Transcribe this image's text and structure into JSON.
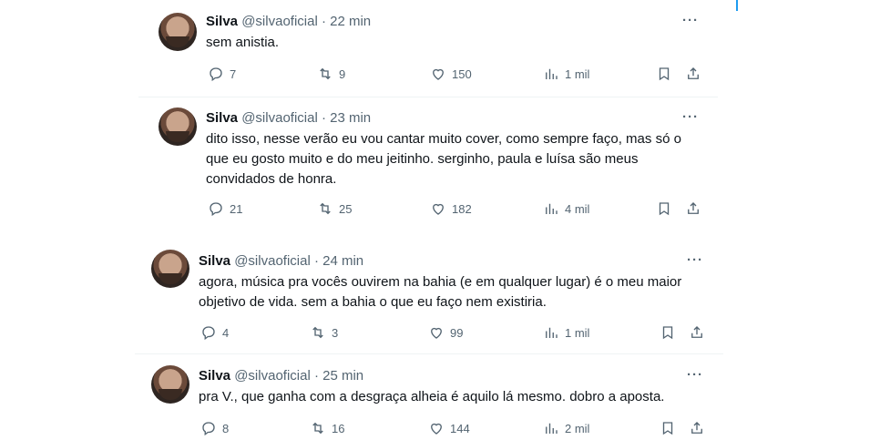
{
  "tweets": [
    {
      "name": "Silva",
      "handle": "@silvaoficial",
      "time": "· 22 min",
      "text": "sem anistia.",
      "replies": "7",
      "retweets": "9",
      "likes": "150",
      "views": "1 mil",
      "more": "···"
    },
    {
      "name": "Silva",
      "handle": "@silvaoficial",
      "time": "· 23 min",
      "text": "dito isso, nesse verão eu vou cantar muito cover, como sempre faço, mas só o que eu gosto muito e do meu jeitinho. serginho, paula e luísa são meus convidados de honra.",
      "replies": "21",
      "retweets": "25",
      "likes": "182",
      "views": "4 mil",
      "more": "···"
    },
    {
      "name": "Silva",
      "handle": "@silvaoficial",
      "time": "· 24 min",
      "text": "agora, música pra vocês ouvirem na bahia (e em qualquer lugar) é o meu maior objetivo de vida. sem a bahia o que eu faço nem existiria.",
      "replies": "4",
      "retweets": "3",
      "likes": "99",
      "views": "1 mil",
      "more": "···"
    },
    {
      "name": "Silva",
      "handle": "@silvaoficial",
      "time": "· 25 min",
      "text": "pra V., que ganha com a desgraça alheia é aquilo lá mesmo. dobro a aposta.",
      "replies": "8",
      "retweets": "16",
      "likes": "144",
      "views": "2 mil",
      "more": "···"
    }
  ],
  "icons": {
    "reply": "reply-icon",
    "retweet": "retweet-icon",
    "like": "heart-icon",
    "views": "views-icon",
    "bookmark": "bookmark-icon",
    "share": "share-icon"
  }
}
